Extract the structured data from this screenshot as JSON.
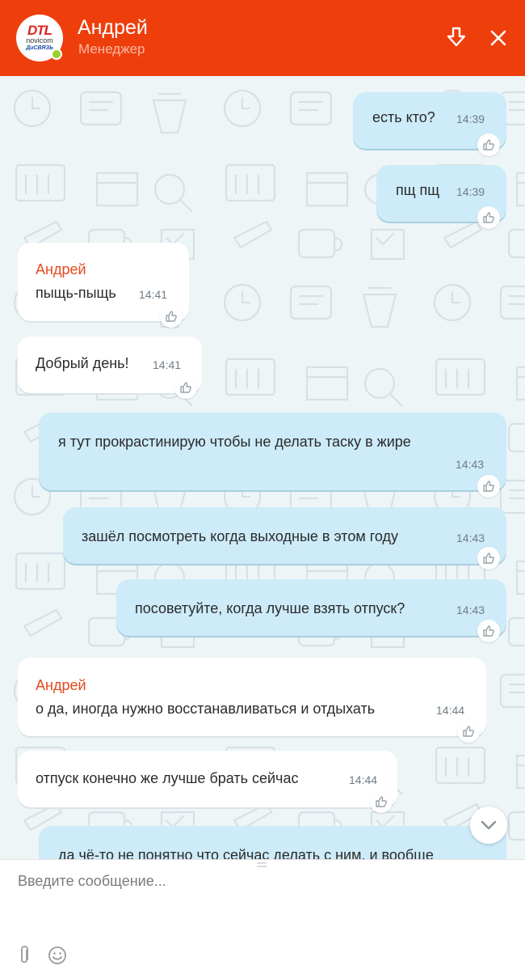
{
  "header": {
    "logo_top": "DTL",
    "logo_mid": "novicom",
    "logo_bot": "ДиСВЯЗЬ",
    "name": "Андрей",
    "role": "Менеджер",
    "accent": "#ee3e0c"
  },
  "messages": [
    {
      "dir": "out",
      "text": "есть кто?",
      "time": "14:39"
    },
    {
      "dir": "out",
      "text": "пщ пщ",
      "time": "14:39"
    },
    {
      "dir": "in",
      "author": "Андрей",
      "text": "пыщь-пыщь",
      "time": "14:41"
    },
    {
      "dir": "in",
      "text": "Добрый день!",
      "time": "14:41"
    },
    {
      "dir": "out",
      "text": "я тут прокрастинирую чтобы не делать таску в жире",
      "time": "14:43"
    },
    {
      "dir": "out",
      "text": "зашёл посмотреть когда выходные в этом году",
      "time": "14:43"
    },
    {
      "dir": "out",
      "text": "посоветуйте, когда лучше взять отпуск?",
      "time": "14:43"
    },
    {
      "dir": "in",
      "author": "Андрей",
      "text": "о да, иногда нужно восстанавливаться и отдыхать",
      "time": "14:44"
    },
    {
      "dir": "in",
      "text": "отпуск конечно же лучше брать сейчас",
      "time": "14:44"
    },
    {
      "dir": "out",
      "text": "да чё-то не понятно что сейчас делать с ним, и вообще",
      "time": ""
    }
  ],
  "composer": {
    "placeholder": "Введите сообщение..."
  },
  "icons": {
    "download": "download-icon",
    "close": "close-icon",
    "like": "thumbs-up-icon",
    "scroll": "chevron-down-icon",
    "attach": "paperclip-icon",
    "emoji": "smiley-icon"
  }
}
